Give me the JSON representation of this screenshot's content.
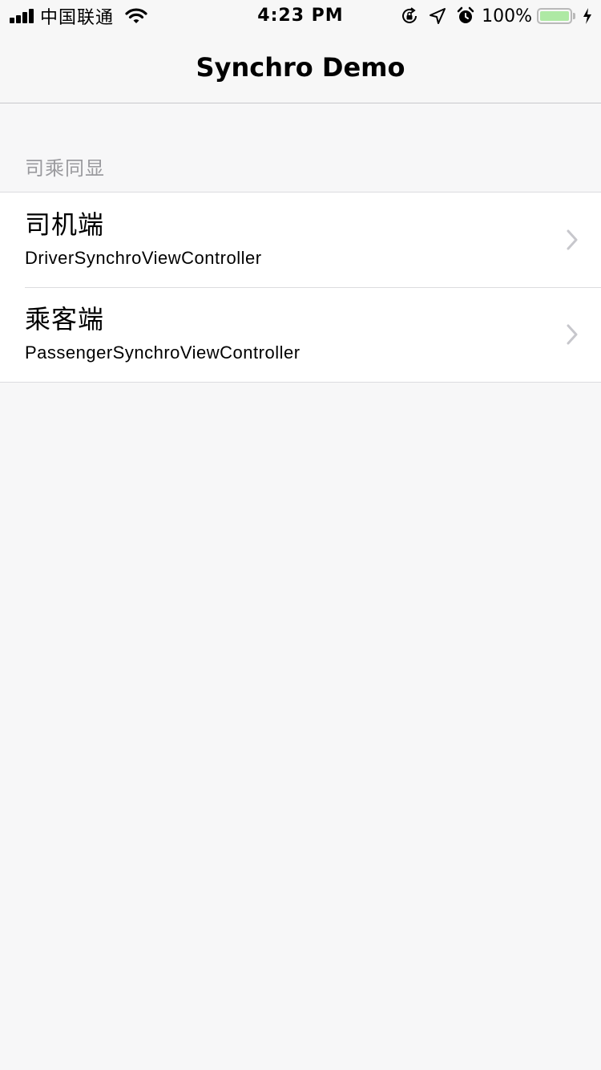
{
  "status_bar": {
    "carrier": "中国联通",
    "time": "4:23 PM",
    "battery_percent": "100%",
    "battery_level": 1.0,
    "battery_color": "#aee9a4",
    "icons": [
      "signal-icon",
      "wifi-icon",
      "orientation-lock-icon",
      "location-icon",
      "alarm-icon",
      "battery-icon",
      "charging-icon"
    ]
  },
  "nav": {
    "title": "Synchro Demo"
  },
  "section": {
    "header": "司乘同显",
    "rows": [
      {
        "title": "司机端",
        "subtitle": "DriverSynchroViewController",
        "accessory": "chevron-right-icon"
      },
      {
        "title": "乘客端",
        "subtitle": "PassengerSynchroViewController",
        "accessory": "chevron-right-icon"
      }
    ]
  }
}
